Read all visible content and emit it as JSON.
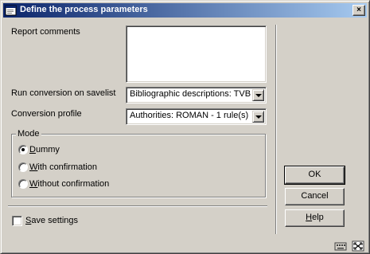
{
  "window": {
    "title": "Define the process parameters",
    "close_glyph": "×"
  },
  "form": {
    "report_comments_label": "Report comments",
    "report_comments_value": "",
    "savelist_label": "Run conversion on savelist",
    "savelist_value": "Bibliographic descriptions: TVB",
    "profile_label": "Conversion profile",
    "profile_value": "Authorities: ROMAN - 1 rule(s)"
  },
  "mode": {
    "legend": "Mode",
    "options": [
      {
        "first": "D",
        "rest": "ummy",
        "selected": true
      },
      {
        "first": "W",
        "rest": "ith confirmation",
        "selected": false
      },
      {
        "first": "W",
        "rest": "ithout confirmation",
        "selected": false
      }
    ]
  },
  "save_settings": {
    "first": "S",
    "rest": "ave settings",
    "checked": false
  },
  "buttons": {
    "ok": "OK",
    "cancel": "Cancel",
    "help_first": "H",
    "help_rest": "elp"
  },
  "icons": {
    "title": "app-window-icon",
    "status_left": "keyboard-icon",
    "status_right": "resize-grip-icon"
  }
}
